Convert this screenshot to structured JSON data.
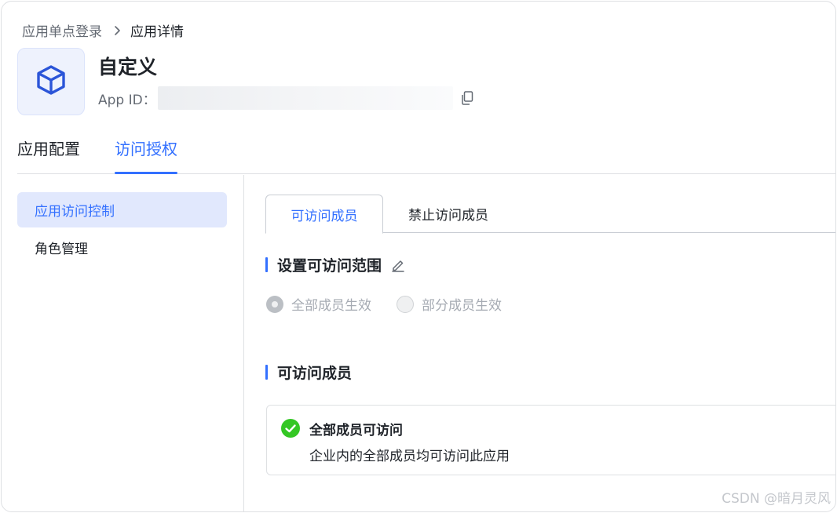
{
  "breadcrumb": {
    "parent": "应用单点登录",
    "current": "应用详情"
  },
  "app": {
    "name": "自定义",
    "id_label": "App ID：",
    "icon": "cube-icon",
    "accent": "#3370ff"
  },
  "main_tabs": [
    {
      "label": "应用配置",
      "active": false
    },
    {
      "label": "访问授权",
      "active": true
    }
  ],
  "sidebar": {
    "items": [
      {
        "label": "应用访问控制",
        "active": true
      },
      {
        "label": "角色管理",
        "active": false
      }
    ]
  },
  "sub_tabs": [
    {
      "label": "可访问成员",
      "active": true
    },
    {
      "label": "禁止访问成员",
      "active": false
    }
  ],
  "range_section": {
    "title": "设置可访问范围",
    "options": [
      {
        "label": "全部成员生效",
        "checked": true,
        "disabled": true
      },
      {
        "label": "部分成员生效",
        "checked": false,
        "disabled": true
      }
    ]
  },
  "members_section": {
    "title": "可访问成员",
    "card": {
      "title": "全部成员可访问",
      "desc": "企业内的全部成员均可访问此应用",
      "status_color": "#34c724"
    }
  },
  "watermark": "CSDN @暗月灵风"
}
